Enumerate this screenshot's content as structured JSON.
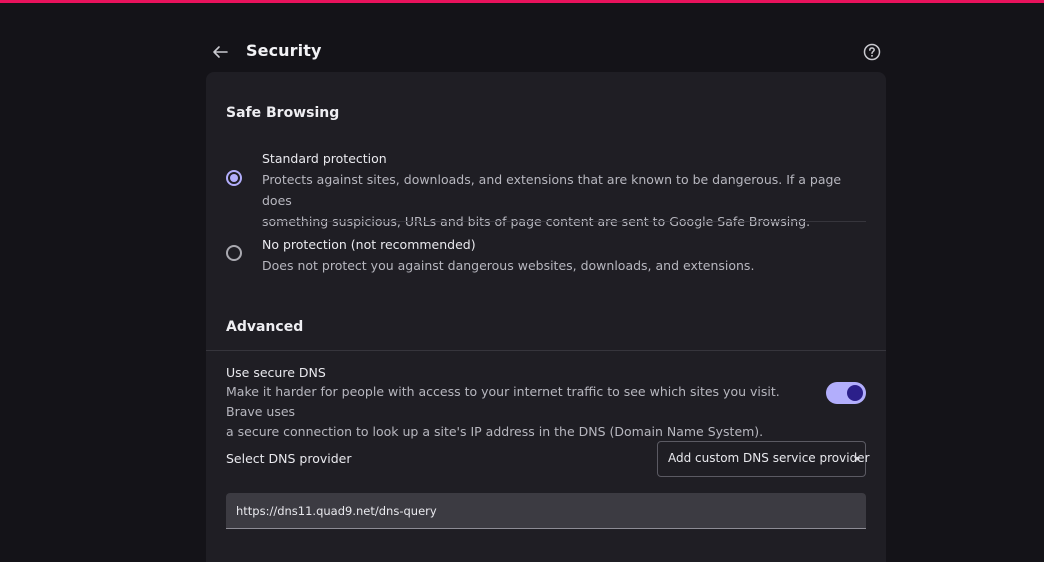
{
  "header": {
    "title": "Security",
    "back_icon": "arrow-left-icon",
    "help_icon": "help-circle-icon"
  },
  "colors": {
    "accent_top_bar": "#e8125c",
    "accent_control": "#b2aefc",
    "background": "#141318",
    "card": "#1f1e24"
  },
  "safe_browsing": {
    "title": "Safe Browsing",
    "selected": "standard",
    "options": [
      {
        "label": "Standard protection",
        "desc_line1": "Protects against sites, downloads, and extensions that are known to be dangerous. If a page does",
        "desc_line2": "something suspicious, URLs and bits of page content are sent to Google Safe Browsing.",
        "checked": true
      },
      {
        "label": "No protection (not recommended)",
        "desc_line1": "Does not protect you against dangerous websites, downloads, and extensions.",
        "checked": false
      }
    ]
  },
  "advanced": {
    "title": "Advanced",
    "secure_dns": {
      "label": "Use secure DNS",
      "desc_line1": "Make it harder for people with access to your internet traffic to see which sites you visit. Brave uses",
      "desc_line2": "a secure connection to look up a site's IP address in the DNS (Domain Name System).",
      "enabled": true
    },
    "provider": {
      "label": "Select DNS provider",
      "selected": "Add custom DNS service provider",
      "custom_url": "https://dns11.quad9.net/dns-query"
    }
  }
}
